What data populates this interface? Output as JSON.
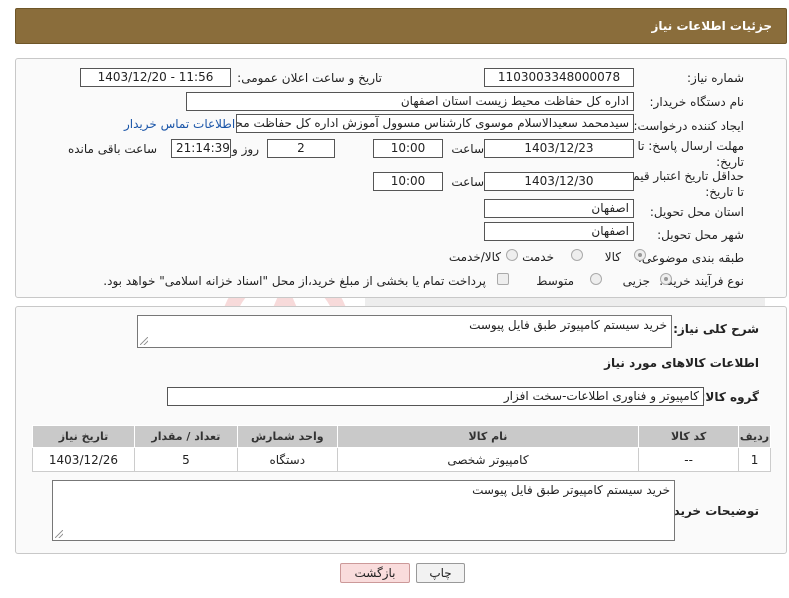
{
  "header": {
    "title": "جزئیات اطلاعات نیاز"
  },
  "fields": {
    "need_number_label": "شماره نیاز:",
    "need_number": "1103003348000078",
    "announce_label": "تاریخ و ساعت اعلان عمومی:",
    "announce_value": "1403/12/20 - 11:56",
    "buyer_org_label": "نام دستگاه خریدار:",
    "buyer_org": "اداره کل حفاظت محیط زیست استان اصفهان",
    "requester_label": "ایجاد کننده درخواست:",
    "requester": "سیدمحمد سعیدالاسلام موسوی کارشناس مسوول آموزش اداره کل حفاظت محیط",
    "contact_link": "اطلاعات تماس خریدار",
    "reply_deadline_label": "مهلت ارسال پاسخ: تا تاریخ:",
    "reply_date": "1403/12/23",
    "time_label": "ساعت",
    "reply_time": "10:00",
    "days_value": "2",
    "days_label": "روز و",
    "remaining_time": "21:14:39",
    "remaining_label": "ساعت باقی مانده",
    "validity_label": "حداقل تاریخ اعتبار قیمت: تا تاریخ:",
    "validity_date": "1403/12/30",
    "validity_time": "10:00",
    "province_label": "استان محل تحویل:",
    "province": "اصفهان",
    "city_label": "شهر محل تحویل:",
    "city": "اصفهان",
    "category_label": "طبقه بندی موضوعی:",
    "category_options": [
      "کالا",
      "خدمت",
      "کالا/خدمت"
    ],
    "process_label": "نوع فرآیند خرید :",
    "process_options": [
      "جزیی",
      "متوسط"
    ],
    "payment_note": "پرداخت تمام یا بخشی از مبلغ خرید،از محل \"اسناد خزانه اسلامی\" خواهد بود."
  },
  "summary": {
    "label": "شرح کلی نیاز:",
    "value": "خرید سیستم کامپیوتر طبق فایل پیوست",
    "goods_info_title": "اطلاعات کالاهای مورد نیاز",
    "group_label": "گروه کالا:",
    "group_value": "کامپیوتر و فناوری اطلاعات-سخت افزار"
  },
  "table": {
    "headers": [
      "ردیف",
      "کد کالا",
      "نام کالا",
      "واحد شمارش",
      "تعداد / مقدار",
      "تاریخ نیاز"
    ],
    "rows": [
      [
        "1",
        "--",
        "کامپیوتر شخصی",
        "دستگاه",
        "5",
        "1403/12/26"
      ]
    ]
  },
  "buyer_notes": {
    "label": "توضیحات خریدار:",
    "value": "خرید سیستم کامپیوتر طبق فایل پیوست"
  },
  "buttons": {
    "print": "چاپ",
    "back": "بازگشت"
  },
  "colors": {
    "header": "#8a6d3b",
    "back_button": "#f9dcdc",
    "link": "#1a55a8"
  }
}
